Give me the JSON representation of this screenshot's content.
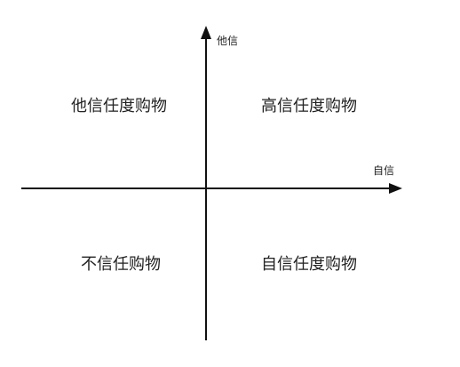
{
  "axes": {
    "y_label": "他信",
    "x_label": "自信",
    "line_color": "#111111"
  },
  "quadrants": {
    "top_left": "他信任度购物",
    "top_right": "高信任度购物",
    "bottom_left": "不信任购物",
    "bottom_right": "自信任度购物"
  }
}
